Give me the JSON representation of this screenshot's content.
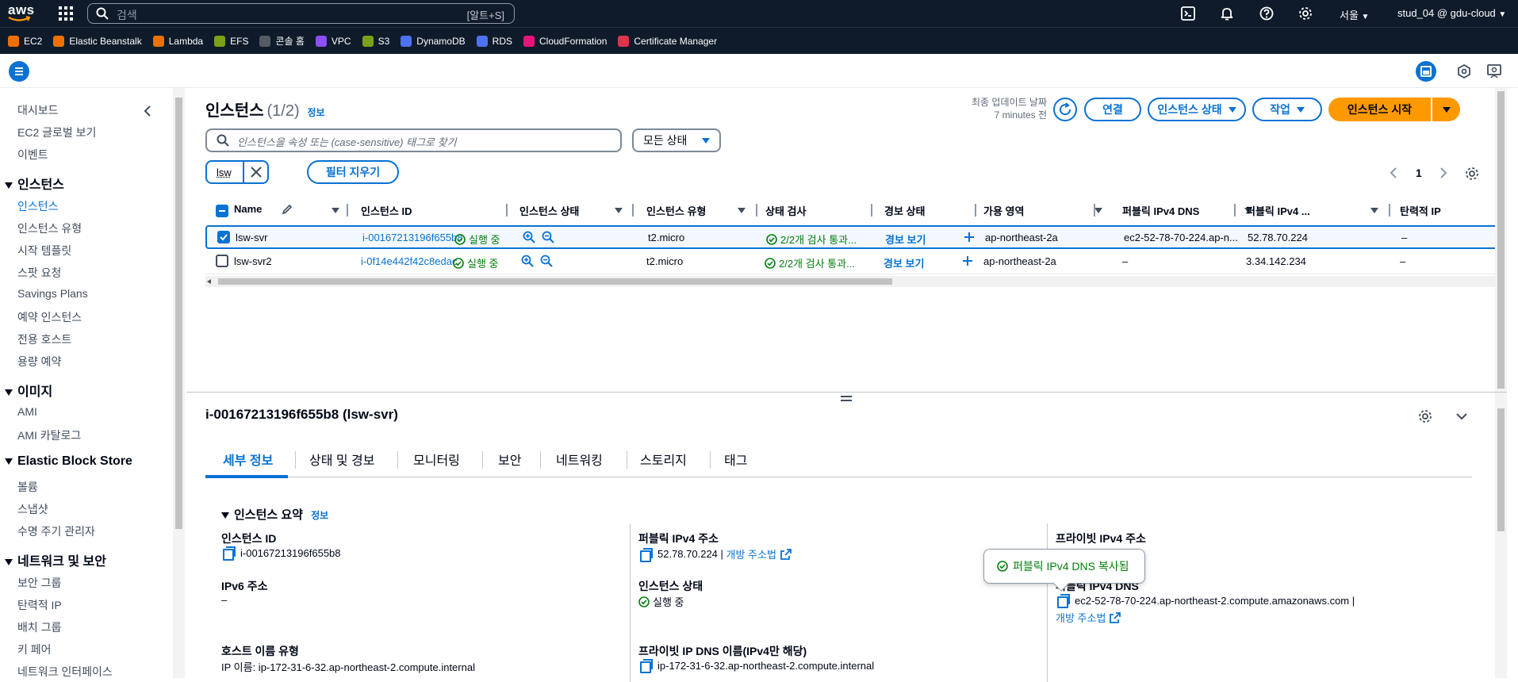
{
  "topbar": {
    "logo_text": "aws",
    "search_placeholder": "검색",
    "search_shortcut": "[알트+S]",
    "region": "서울",
    "account": "stud_04 @ gdu-cloud"
  },
  "favorites": [
    {
      "label": "EC2",
      "color": "#ed7100"
    },
    {
      "label": "Elastic Beanstalk",
      "color": "#ed7100"
    },
    {
      "label": "Lambda",
      "color": "#ed7100"
    },
    {
      "label": "EFS",
      "color": "#7aa116"
    },
    {
      "label": "콘솔 홈",
      "color": "#545b64"
    },
    {
      "label": "VPC",
      "color": "#8c4fff"
    },
    {
      "label": "S3",
      "color": "#7aa116"
    },
    {
      "label": "DynamoDB",
      "color": "#4d72f3"
    },
    {
      "label": "RDS",
      "color": "#4d72f3"
    },
    {
      "label": "CloudFormation",
      "color": "#e7157b"
    },
    {
      "label": "Certificate Manager",
      "color": "#dd344c"
    }
  ],
  "sidebar": {
    "top_items": [
      "대시보드",
      "EC2 글로벌 보기",
      "이벤트"
    ],
    "sections": [
      {
        "title": "인스턴스",
        "items": [
          "인스턴스",
          "인스턴스 유형",
          "시작 템플릿",
          "스팟 요청",
          "Savings Plans",
          "예약 인스턴스",
          "전용 호스트",
          "용량 예약"
        ]
      },
      {
        "title": "이미지",
        "items": [
          "AMI",
          "AMI 카탈로그"
        ]
      },
      {
        "title": "Elastic Block Store",
        "items": [
          "볼륨",
          "스냅샷",
          "수명 주기 관리자"
        ]
      },
      {
        "title": "네트워크 및 보안",
        "items": [
          "보안 그룹",
          "탄력적 IP",
          "배치 그룹",
          "키 페어",
          "네트워크 인터페이스"
        ]
      }
    ]
  },
  "header": {
    "title": "인스턴스",
    "count": "(1/2)",
    "info": "정보",
    "last_updated_label": "최종 업데이트 날짜",
    "last_updated_value": "7 minutes 전",
    "connect": "연결",
    "instance_state": "인스턴스 상태",
    "actions": "작업",
    "launch": "인스턴스 시작"
  },
  "filter": {
    "search_placeholder": "인스턴스을 속성 또는 (case-sensitive) 태그로 찾기",
    "state_select": "모든 상태",
    "token": "lsw",
    "clear": "필터 지우기",
    "page": "1"
  },
  "table": {
    "columns": [
      "Name",
      "인스턴스 ID",
      "인스턴스 상태",
      "인스턴스 유형",
      "상태 검사",
      "경보 상태",
      "가용 영역",
      "퍼블릭 IPv4 DNS",
      "퍼블릭 IPv4 ...",
      "탄력적 IP"
    ],
    "rows": [
      {
        "name": "lsw-svr",
        "id": "i-00167213196f655b8",
        "state": "실행 중",
        "type": "t2.micro",
        "check": "2/2개 검사 통과...",
        "alarm": "경보 보기",
        "az": "ap-northeast-2a",
        "dns": "ec2-52-78-70-224.ap-n...",
        "ip": "52.78.70.224",
        "eip": "–"
      },
      {
        "name": "lsw-svr2",
        "id": "i-0f14e442f42c8edac",
        "state": "실행 중",
        "type": "t2.micro",
        "check": "2/2개 검사 통과...",
        "alarm": "경보 보기",
        "az": "ap-northeast-2a",
        "dns": "–",
        "ip": "3.34.142.234",
        "eip": "–"
      }
    ]
  },
  "detail": {
    "title": "i-00167213196f655b8 (lsw-svr)",
    "tabs": [
      "세부 정보",
      "상태 및 경보",
      "모니터링",
      "보안",
      "네트워킹",
      "스토리지",
      "태그"
    ],
    "summary_title": "인스턴스 요약",
    "summary_info": "정보",
    "fields": {
      "instance_id_label": "인스턴스 ID",
      "instance_id": "i-00167213196f655b8",
      "public_ipv4_label": "퍼블릭 IPv4 주소",
      "public_ipv4": "52.78.70.224",
      "open_address": "개방 주소법",
      "private_ipv4_label": "프라이빗 IPv4 주소",
      "ipv6_label": "IPv6 주소",
      "ipv6": "–",
      "state_label": "인스턴스 상태",
      "state": "실행 중",
      "public_dns_label": "퍼블릭 IPv4 DNS",
      "public_dns": "ec2-52-78-70-224.ap-northeast-2.compute.amazonaws.com",
      "open_address2": "개방 주소법",
      "hostname_type_label": "호스트 이름 유형",
      "hostname_type": "IP 이름: ip-172-31-6-32.ap-northeast-2.compute.internal",
      "private_dns_label": "프라이빗 IP DNS 이름(IPv4만 해당)",
      "private_dns": "ip-172-31-6-32.ap-northeast-2.compute.internal"
    },
    "toast": "퍼블릭 IPv4 DNS 복사됨"
  }
}
